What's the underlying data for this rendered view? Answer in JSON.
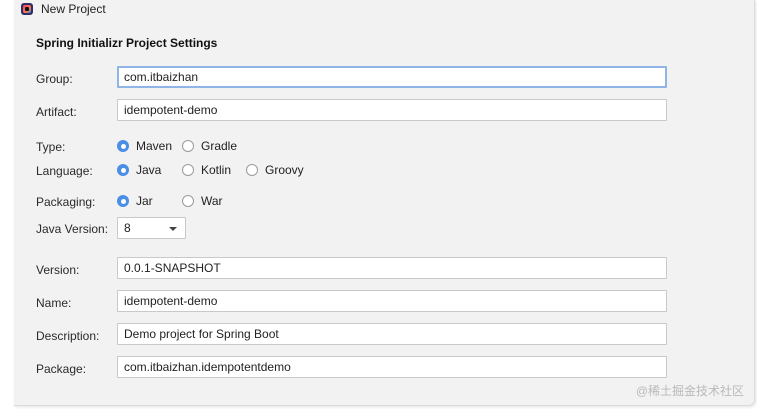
{
  "window": {
    "title": "New Project"
  },
  "section_title": "Spring Initializr Project Settings",
  "fields": {
    "group": {
      "label": "Group:",
      "value": "com.itbaizhan"
    },
    "artifact": {
      "label": "Artifact:",
      "value": "idempotent-demo"
    },
    "version": {
      "label": "Version:",
      "value": "0.0.1-SNAPSHOT"
    },
    "name": {
      "label": "Name:",
      "value": "idempotent-demo"
    },
    "description": {
      "label": "Description:",
      "value": "Demo project for Spring Boot"
    },
    "package": {
      "label": "Package:",
      "value": "com.itbaizhan.idempotentdemo"
    }
  },
  "type": {
    "label": "Type:",
    "options": [
      "Maven",
      "Gradle"
    ],
    "selected": "Maven"
  },
  "language": {
    "label": "Language:",
    "options": [
      "Java",
      "Kotlin",
      "Groovy"
    ],
    "selected": "Java"
  },
  "packaging": {
    "label": "Packaging:",
    "options": [
      "Jar",
      "War"
    ],
    "selected": "Jar"
  },
  "java_version": {
    "label": "Java Version:",
    "value": "8"
  },
  "watermark": "@稀土掘金技术社区",
  "colors": {
    "accent": "#4a8ee6",
    "focus_border": "#8fb5e6",
    "background": "#f2f2f2"
  }
}
